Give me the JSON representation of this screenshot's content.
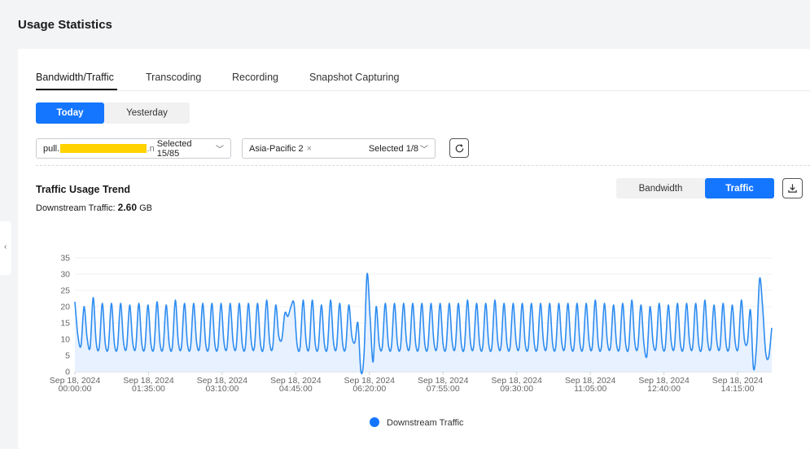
{
  "page": {
    "title": "Usage Statistics"
  },
  "tabs": [
    {
      "label": "Bandwidth/Traffic",
      "active": true
    },
    {
      "label": "Transcoding",
      "active": false
    },
    {
      "label": "Recording",
      "active": false
    },
    {
      "label": "Snapshot Capturing",
      "active": false
    }
  ],
  "date_range": {
    "today": "Today",
    "yesterday": "Yesterday",
    "selected": "Today"
  },
  "filters": {
    "domain": {
      "prefix": "pull.",
      "suffix": ".n",
      "selected": "Selected 15/85"
    },
    "region": {
      "tag": "Asia-Pacific 2",
      "selected": "Selected 1/8"
    }
  },
  "trend": {
    "title": "Traffic Usage Trend",
    "summary_label": "Downstream Traffic:",
    "summary_value": "2.60",
    "summary_unit": "GB",
    "mode_bandwidth": "Bandwidth",
    "mode_traffic": "Traffic",
    "selected_mode": "Traffic"
  },
  "colors": {
    "accent": "#1476ff",
    "series": "#2d8cf0",
    "area": "#e3efff"
  },
  "icons": [
    "refresh-icon",
    "download-icon",
    "chevron-down-icon",
    "close-icon",
    "collapse-chevron-icon"
  ],
  "chart_data": {
    "type": "area",
    "ylim": [
      0,
      35
    ],
    "yticks": [
      0,
      5,
      10,
      15,
      20,
      25,
      30,
      35
    ],
    "xlim_minutes": [
      0,
      875
    ],
    "xticks": [
      {
        "date": "Sep 18, 2024",
        "time": "00:00:00"
      },
      {
        "date": "Sep 18, 2024",
        "time": "01:35:00"
      },
      {
        "date": "Sep 18, 2024",
        "time": "03:10:00"
      },
      {
        "date": "Sep 18, 2024",
        "time": "04:45:00"
      },
      {
        "date": "Sep 18, 2024",
        "time": "06:20:00"
      },
      {
        "date": "Sep 18, 2024",
        "time": "07:55:00"
      },
      {
        "date": "Sep 18, 2024",
        "time": "09:30:00"
      },
      {
        "date": "Sep 18, 2024",
        "time": "11:05:00"
      },
      {
        "date": "Sep 18, 2024",
        "time": "12:40:00"
      },
      {
        "date": "Sep 18, 2024",
        "time": "14:15:00"
      }
    ],
    "legend": [
      "Downstream Traffic"
    ],
    "series": [
      {
        "name": "Downstream Traffic",
        "values": [
          21.5,
          11,
          8,
          20,
          10.5,
          7.5,
          22.8,
          9,
          7.5,
          21,
          8.5,
          7.5,
          21,
          8.5,
          7.5,
          21,
          9,
          7.5,
          20.5,
          9,
          7.5,
          21,
          8.5,
          7.5,
          20.5,
          8.5,
          7.5,
          21.5,
          8.5,
          7.5,
          20.5,
          8.5,
          7.5,
          22,
          9,
          7.5,
          21,
          8.5,
          7.5,
          21,
          9,
          7.5,
          21,
          8.5,
          7.5,
          21,
          8.5,
          7.5,
          21,
          9,
          7.5,
          21,
          9,
          7.5,
          21,
          8.5,
          7.5,
          21,
          9,
          7.5,
          21,
          8.5,
          7.5,
          22,
          9,
          7.5,
          20.5,
          11,
          10,
          18,
          17,
          20,
          21,
          8.5,
          7.5,
          22,
          9,
          7.5,
          22,
          8.5,
          7.5,
          20.5,
          8.5,
          7.5,
          22,
          9,
          7.5,
          21,
          8.5,
          7.5,
          20.5,
          11,
          9,
          15,
          0,
          5,
          30,
          17,
          3,
          20,
          8.5,
          7.5,
          21,
          8.5,
          7.5,
          21,
          8.5,
          7.5,
          21,
          9,
          7.5,
          21,
          8.5,
          7.5,
          21,
          8.5,
          7.5,
          21,
          9,
          7.5,
          21,
          8.5,
          7.5,
          21,
          9,
          7.5,
          21,
          8.5,
          7.5,
          22,
          9,
          7.5,
          21,
          8.5,
          7.5,
          21,
          8.5,
          7.5,
          22,
          9,
          7.5,
          21,
          8.5,
          7.5,
          21,
          9,
          7.5,
          21,
          8.5,
          7.5,
          21,
          8.5,
          7.5,
          21,
          9,
          7.5,
          21,
          8.5,
          7.5,
          21,
          9,
          7.5,
          21,
          8.5,
          7.5,
          21,
          8.5,
          7.5,
          21,
          9,
          7.5,
          22,
          8.5,
          7.5,
          21,
          9,
          7.5,
          20.5,
          8.5,
          7.5,
          21,
          8.5,
          7.5,
          22,
          9,
          7.5,
          20.5,
          8.5,
          5,
          20,
          9,
          7.5,
          21,
          8.5,
          7.5,
          20.5,
          9,
          7.5,
          21,
          8.5,
          7.5,
          21,
          9,
          7.5,
          21,
          8.5,
          7.5,
          22,
          9,
          7.5,
          20.5,
          9,
          7.5,
          21,
          8.5,
          7.5,
          20.5,
          9,
          7.5,
          22,
          10,
          9,
          19,
          1,
          8,
          28.5,
          20,
          6,
          4.5,
          13.5
        ]
      }
    ]
  }
}
